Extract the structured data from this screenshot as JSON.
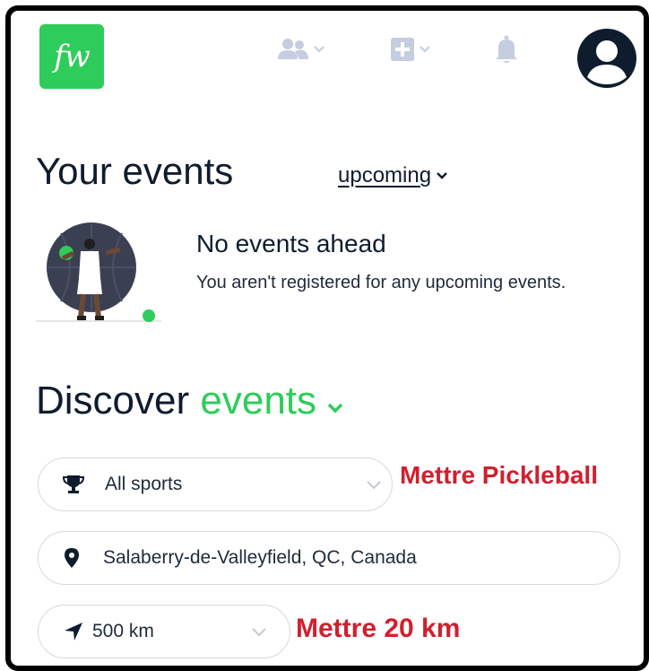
{
  "header": {
    "logo_text": "fw",
    "icons": [
      "people-icon",
      "plus-square-icon",
      "bell-icon",
      "user-avatar-icon"
    ]
  },
  "events": {
    "title": "Your events",
    "filter_label": "upcoming",
    "empty_title": "No events ahead",
    "empty_message": "You aren't registered for any upcoming events."
  },
  "discover": {
    "title_part1": "Discover",
    "title_part2": "events",
    "sport_value": "All sports",
    "location_value": "Salaberry-de-Valleyfield, QC, Canada",
    "distance_value": "500 km"
  },
  "annotations": {
    "sport_note": "Mettre Pickleball",
    "distance_note": "Mettre 20 km"
  },
  "colors": {
    "brand_green": "#2ecc5a",
    "annotation_red": "#d0202f",
    "text_dark": "#0f1c2e",
    "icon_muted": "#c5cde0"
  }
}
